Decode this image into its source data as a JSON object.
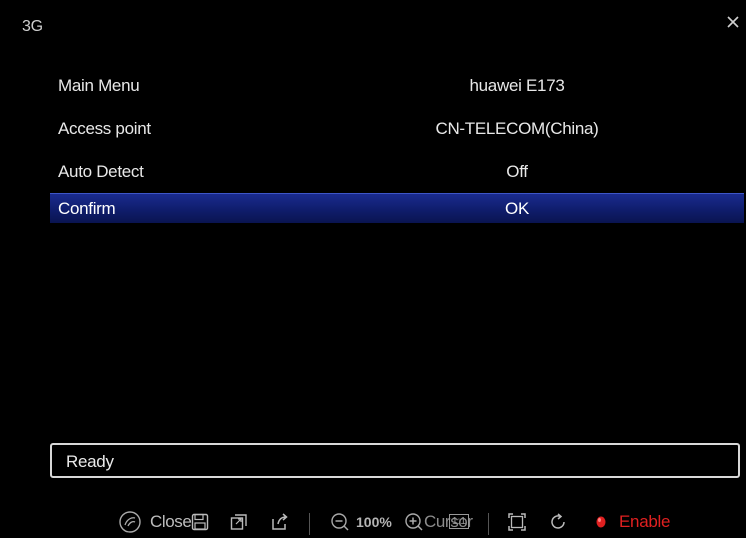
{
  "window": {
    "title": "3G"
  },
  "menu": {
    "rows": [
      {
        "label": "Main Menu",
        "value": "huawei E173"
      },
      {
        "label": "Access point",
        "value": "CN-TELECOM(China)"
      },
      {
        "label": "Auto Detect",
        "value": "Off"
      },
      {
        "label": "Confirm",
        "value": "OK",
        "selected": true
      }
    ]
  },
  "status": {
    "text": "Ready"
  },
  "toolbar": {
    "close_label": "Close",
    "zoom_label": "100%",
    "cursor_label": "Cursor",
    "ratio_label": "1:1",
    "enable_label": "Enable",
    "enable_color": "#e02020"
  },
  "colors": {
    "selection": "#132276",
    "background": "#000000"
  }
}
